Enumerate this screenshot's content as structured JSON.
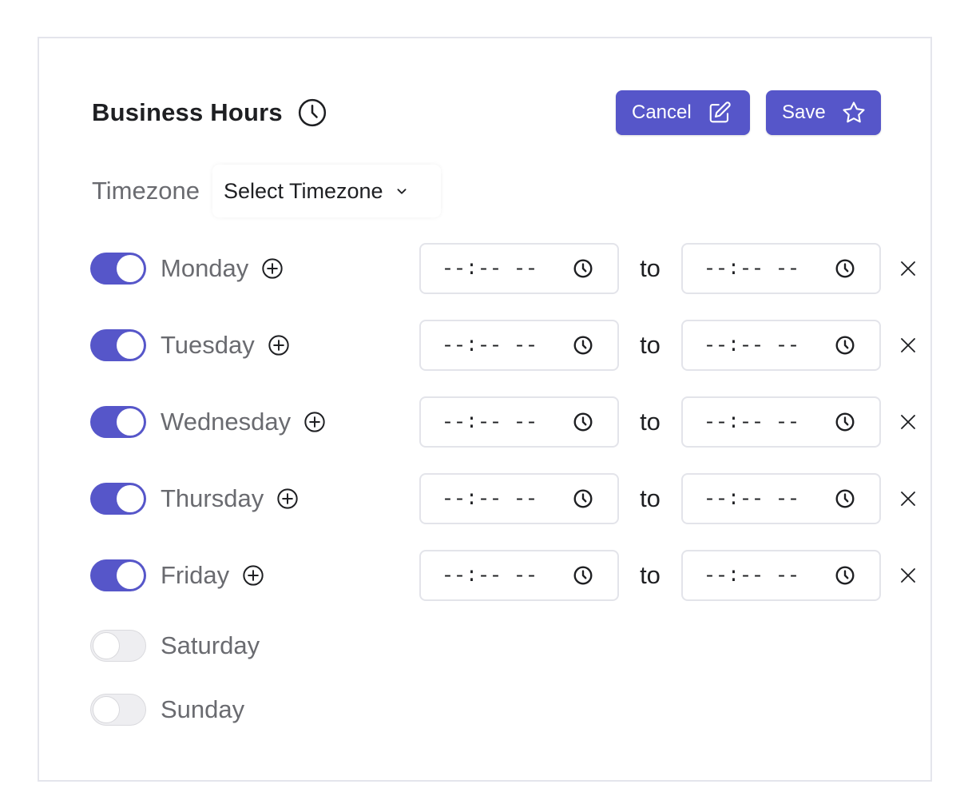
{
  "header": {
    "title": "Business Hours",
    "cancel_label": "Cancel",
    "save_label": "Save"
  },
  "timezone": {
    "label": "Timezone",
    "selected": "Select Timezone"
  },
  "time_placeholder": "--:-- --",
  "to_label": "to",
  "days": [
    {
      "name": "Monday",
      "enabled": true
    },
    {
      "name": "Tuesday",
      "enabled": true
    },
    {
      "name": "Wednesday",
      "enabled": true
    },
    {
      "name": "Thursday",
      "enabled": true
    },
    {
      "name": "Friday",
      "enabled": true
    },
    {
      "name": "Saturday",
      "enabled": false
    },
    {
      "name": "Sunday",
      "enabled": false
    }
  ],
  "icons": {
    "title": "clock-icon",
    "cancel": "edit-icon",
    "save": "star-icon",
    "timezone": "chevron-down-icon",
    "add": "plus-circle-icon",
    "time": "clock-icon",
    "remove": "close-icon"
  },
  "colors": {
    "accent": "#5656c9",
    "toggle_off": "#eeeef1",
    "border": "#e3e4ea",
    "muted_text": "#6a6b70"
  }
}
